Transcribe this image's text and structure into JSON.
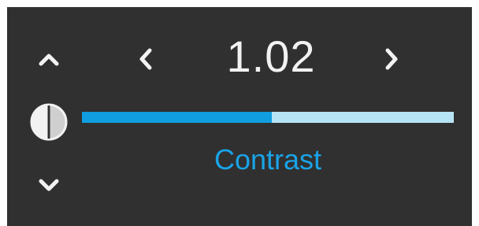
{
  "contrast_control": {
    "value": "1.02",
    "label": "Contrast",
    "slider_level": 0.51,
    "icons": {
      "nav_up": "chevron-up-icon",
      "nav_down": "chevron-down-icon",
      "decrease": "chevron-left-icon",
      "increase": "chevron-right-icon",
      "setting": "contrast-icon"
    },
    "colors": {
      "panel_background": "#303030",
      "value_text": "#f2f2f2",
      "label_text": "#1aa3e6",
      "slider_fill": "#109ee0",
      "slider_track": "#b7e4f5"
    }
  }
}
